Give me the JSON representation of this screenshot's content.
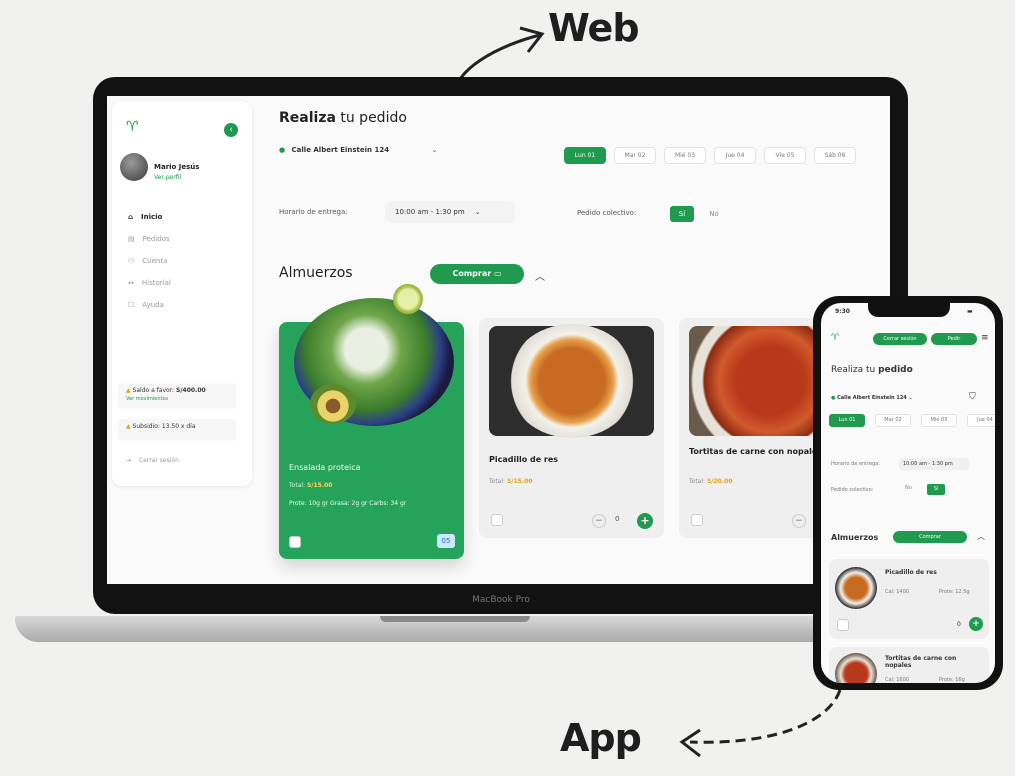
{
  "captions": {
    "web": "Web",
    "app": "App"
  },
  "laptop": {
    "brand": "MacBook Pro"
  },
  "sidebar": {
    "user_name": "Mario Jesús",
    "user_link": "Ver perfil",
    "nav": [
      {
        "label": "Inicio",
        "icon": "home-icon"
      },
      {
        "label": "Pedidos",
        "icon": "clipboard-icon"
      },
      {
        "label": "Cuenta",
        "icon": "user-icon"
      },
      {
        "label": "Historial",
        "icon": "history-icon"
      },
      {
        "label": "Ayuda",
        "icon": "help-icon"
      }
    ],
    "balance_label": "Saldo a favor:",
    "balance_value": "S/400.00",
    "balance_link": "Ver movimientos",
    "subsidy": "Subsidio: 13.50 x día",
    "logout": "Cerrar sesión"
  },
  "main": {
    "title_bold": "Realiza",
    "title_rest": " tu pedido",
    "address": "Calle Albert Einstein 124",
    "days": [
      "Lun 01",
      "Mar 02",
      "Mié 03",
      "Jue 04",
      "Vie 05",
      "Sáb 06"
    ],
    "active_day": 0,
    "delivery_label": "Horario de entrega:",
    "delivery_value": "10:00 am - 1:30 pm",
    "collective_label": "Pedido colectivo:",
    "toggle_yes": "Sí",
    "toggle_no": "No",
    "section_title": "Almuerzos",
    "buy_label": "Comprar",
    "cards": [
      {
        "name": "Ensalada proteica",
        "price_label": "Total:",
        "price": "S/15.00",
        "macros": "Prote: 10g gr  Grasa: 2g gr  Carbs: 34 gr",
        "qty": "05"
      },
      {
        "name": "Picadillo de res",
        "price_label": "Total:",
        "price": "S/15.00",
        "qty": "0"
      },
      {
        "name": "Tortitas de carne con nopales",
        "price_label": "Total:",
        "price": "S/20.00",
        "qty": "0"
      }
    ]
  },
  "phone": {
    "time": "9:30",
    "btn1": "Cerrar sesión",
    "btn2": "Pedir",
    "title_bold": "pedido",
    "title_rest": "Realiza tu ",
    "address": "Calle Albert Einstein 124",
    "days": [
      "Lun 01",
      "Mar 02",
      "Mié 03",
      "Jue 04"
    ],
    "delivery_label": "Horario de entrega:",
    "delivery_value": "10:00 am - 1:30 pm",
    "collective_label": "Pedido colectivo:",
    "toggle_no": "No",
    "toggle_yes": "Sí",
    "section_title": "Almuerzos",
    "buy_label": "Comprar",
    "items": [
      {
        "name": "Picadillo de res",
        "info1": "Cal: 1400",
        "info2": "Prote: 12.5g",
        "qty": "0"
      },
      {
        "name": "Tortitas de carne con nopales",
        "info1": "Cal: 1600",
        "info2": "Prote: 16g"
      }
    ]
  }
}
